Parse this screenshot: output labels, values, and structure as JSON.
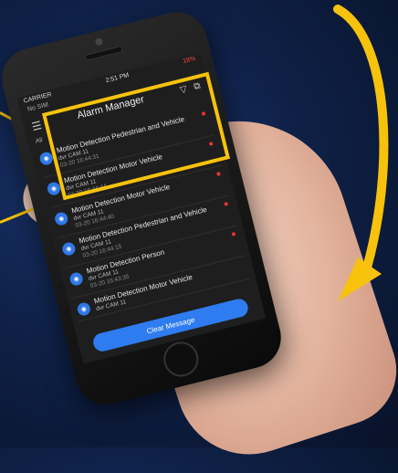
{
  "status": {
    "carrier": "CARRIER",
    "time": "2:51 PM",
    "battery": "18%"
  },
  "nav": {
    "title": "Alarm Manager",
    "sub_left": "No SIM",
    "sub_right": "All"
  },
  "alarms": [
    {
      "title": "Motion Detection Pedestrian and Vehicle",
      "device": "dvr CAM 11",
      "time": "03-20 16:44:31"
    },
    {
      "title": "Motion Detection Motor Vehicle",
      "device": "dvr CAM 11",
      "time": "03-20 16:44:44"
    },
    {
      "title": "Motion Detection Motor Vehicle",
      "device": "dvr CAM 11",
      "time": "03-20 16:44:40"
    },
    {
      "title": "Motion Detection Pedestrian and Vehicle",
      "device": "dvr CAM 11",
      "time": "03-20 16:44:15"
    },
    {
      "title": "Motion Detection Person",
      "device": "dvr CAM 11",
      "time": "03-20 16:43:35"
    },
    {
      "title": "Motion Detection Motor Vehicle",
      "device": "dvr CAM 11",
      "time": ""
    }
  ],
  "clear_label": "Clear Message",
  "colors": {
    "highlight": "#f6c20c",
    "accent": "#2f7cf0",
    "unread": "#e33333"
  }
}
